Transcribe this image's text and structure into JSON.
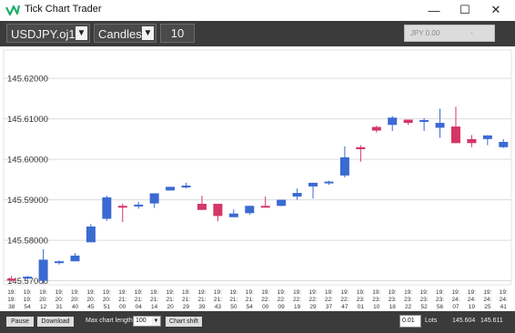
{
  "window": {
    "title": "Tick Chart Trader",
    "minimize": "—",
    "maximize": "☐",
    "close": "✕"
  },
  "toolbar": {
    "symbol": "USDJPY.oj1m",
    "chart_type": "Candles",
    "period": "10",
    "price_button": {
      "label": "JPY 0.00",
      "extra": "-"
    }
  },
  "bottom": {
    "pause": "Pause",
    "download": "Download",
    "max_length_label": "Max chart length:",
    "max_length_value": "100",
    "chart_shift": "Chart shift",
    "lots_value": "0.01",
    "lots_label": "Lots",
    "bid": "145.604",
    "ask": "145.611"
  },
  "colors": {
    "bull": "#3a6ad2",
    "bear": "#d33667",
    "toolbar": "#3b3b3b"
  },
  "chart_data": {
    "type": "candlestick",
    "ylim": [
      145.569,
      145.627
    ],
    "y_ticks": [
      "145.62000",
      "145.61000",
      "145.60000",
      "145.59000",
      "145.58000",
      "145.57000"
    ],
    "x_ticks": [
      [
        "19:",
        "19:",
        "38"
      ],
      [
        "19:",
        "19:",
        "54"
      ],
      [
        "19:",
        "20:",
        "12"
      ],
      [
        "19:",
        "20:",
        "31"
      ],
      [
        "19:",
        "20:",
        "40"
      ],
      [
        "19:",
        "20:",
        "45"
      ],
      [
        "19:",
        "20:",
        "51"
      ],
      [
        "19:",
        "21:",
        "00"
      ],
      [
        "19:",
        "21:",
        "04"
      ],
      [
        "19:",
        "21:",
        "14"
      ],
      [
        "19:",
        "21:",
        "20"
      ],
      [
        "19:",
        "21:",
        "29"
      ],
      [
        "19:",
        "21:",
        "39"
      ],
      [
        "19:",
        "21:",
        "43"
      ],
      [
        "19:",
        "21:",
        "50"
      ],
      [
        "19:",
        "21:",
        "54"
      ],
      [
        "19:",
        "22:",
        "00"
      ],
      [
        "19:",
        "22:",
        "09"
      ],
      [
        "19:",
        "22:",
        "19"
      ],
      [
        "19:",
        "22:",
        "29"
      ],
      [
        "19:",
        "22:",
        "37"
      ],
      [
        "19:",
        "22:",
        "47"
      ],
      [
        "19:",
        "23:",
        "01"
      ],
      [
        "19:",
        "23:",
        "10"
      ],
      [
        "19:",
        "23:",
        "18"
      ],
      [
        "19:",
        "23:",
        "22"
      ],
      [
        "19:",
        "23:",
        "52"
      ],
      [
        "19:",
        "23:",
        "56"
      ],
      [
        "19:",
        "24:",
        "07"
      ],
      [
        "19:",
        "24:",
        "19"
      ],
      [
        "19:",
        "24:",
        "25"
      ],
      [
        "19:",
        "24:",
        "41"
      ]
    ],
    "candles": [
      {
        "o": 145.5705,
        "h": 145.5712,
        "l": 145.5698,
        "c": 145.5703
      },
      {
        "o": 145.5706,
        "h": 145.5712,
        "l": 145.5702,
        "c": 145.571
      },
      {
        "o": 145.57,
        "h": 145.5778,
        "l": 145.5692,
        "c": 145.5752
      },
      {
        "o": 145.5746,
        "h": 145.575,
        "l": 145.574,
        "c": 145.5748
      },
      {
        "o": 145.5748,
        "h": 145.5768,
        "l": 145.5748,
        "c": 145.5762
      },
      {
        "o": 145.5795,
        "h": 145.584,
        "l": 145.5795,
        "c": 145.5834
      },
      {
        "o": 145.5853,
        "h": 145.591,
        "l": 145.5848,
        "c": 145.5906
      },
      {
        "o": 145.5885,
        "h": 145.589,
        "l": 145.5845,
        "c": 145.5881
      },
      {
        "o": 145.5887,
        "h": 145.5895,
        "l": 145.5878,
        "c": 145.5888
      },
      {
        "o": 145.5891,
        "h": 145.5912,
        "l": 145.588,
        "c": 145.5916
      },
      {
        "o": 145.5923,
        "h": 145.593,
        "l": 145.5923,
        "c": 145.5932
      },
      {
        "o": 145.5932,
        "h": 145.5942,
        "l": 145.5928,
        "c": 145.5935
      },
      {
        "o": 145.589,
        "h": 145.591,
        "l": 145.5875,
        "c": 145.5875
      },
      {
        "o": 145.589,
        "h": 145.5885,
        "l": 145.5847,
        "c": 145.586
      },
      {
        "o": 145.5857,
        "h": 145.5876,
        "l": 145.586,
        "c": 145.5866
      },
      {
        "o": 145.5867,
        "h": 145.5884,
        "l": 145.5863,
        "c": 145.5885
      },
      {
        "o": 145.5885,
        "h": 145.5908,
        "l": 145.5885,
        "c": 145.5883
      },
      {
        "o": 145.5885,
        "h": 145.59,
        "l": 145.5884,
        "c": 145.59
      },
      {
        "o": 145.5908,
        "h": 145.5928,
        "l": 145.59,
        "c": 145.5917
      },
      {
        "o": 145.5933,
        "h": 145.5942,
        "l": 145.5903,
        "c": 145.5942
      },
      {
        "o": 145.5943,
        "h": 145.5947,
        "l": 145.5937,
        "c": 145.5945
      },
      {
        "o": 145.596,
        "h": 145.6032,
        "l": 145.5955,
        "c": 145.6005
      },
      {
        "o": 145.603,
        "h": 145.6035,
        "l": 145.5994,
        "c": 145.6025
      },
      {
        "o": 145.608,
        "h": 145.6083,
        "l": 145.6066,
        "c": 145.6071
      },
      {
        "o": 145.6085,
        "h": 145.6107,
        "l": 145.607,
        "c": 145.6103
      },
      {
        "o": 145.6098,
        "h": 145.6098,
        "l": 145.6085,
        "c": 145.609
      },
      {
        "o": 145.6097,
        "h": 145.6102,
        "l": 145.607,
        "c": 145.6097
      },
      {
        "o": 145.6078,
        "h": 145.6125,
        "l": 145.6053,
        "c": 145.609
      },
      {
        "o": 145.6081,
        "h": 145.613,
        "l": 145.604,
        "c": 145.604
      },
      {
        "o": 145.605,
        "h": 145.606,
        "l": 145.603,
        "c": 145.604
      },
      {
        "o": 145.605,
        "h": 145.606,
        "l": 145.6035,
        "c": 145.6059
      },
      {
        "o": 145.603,
        "h": 145.605,
        "l": 145.6028,
        "c": 145.6043
      }
    ]
  }
}
